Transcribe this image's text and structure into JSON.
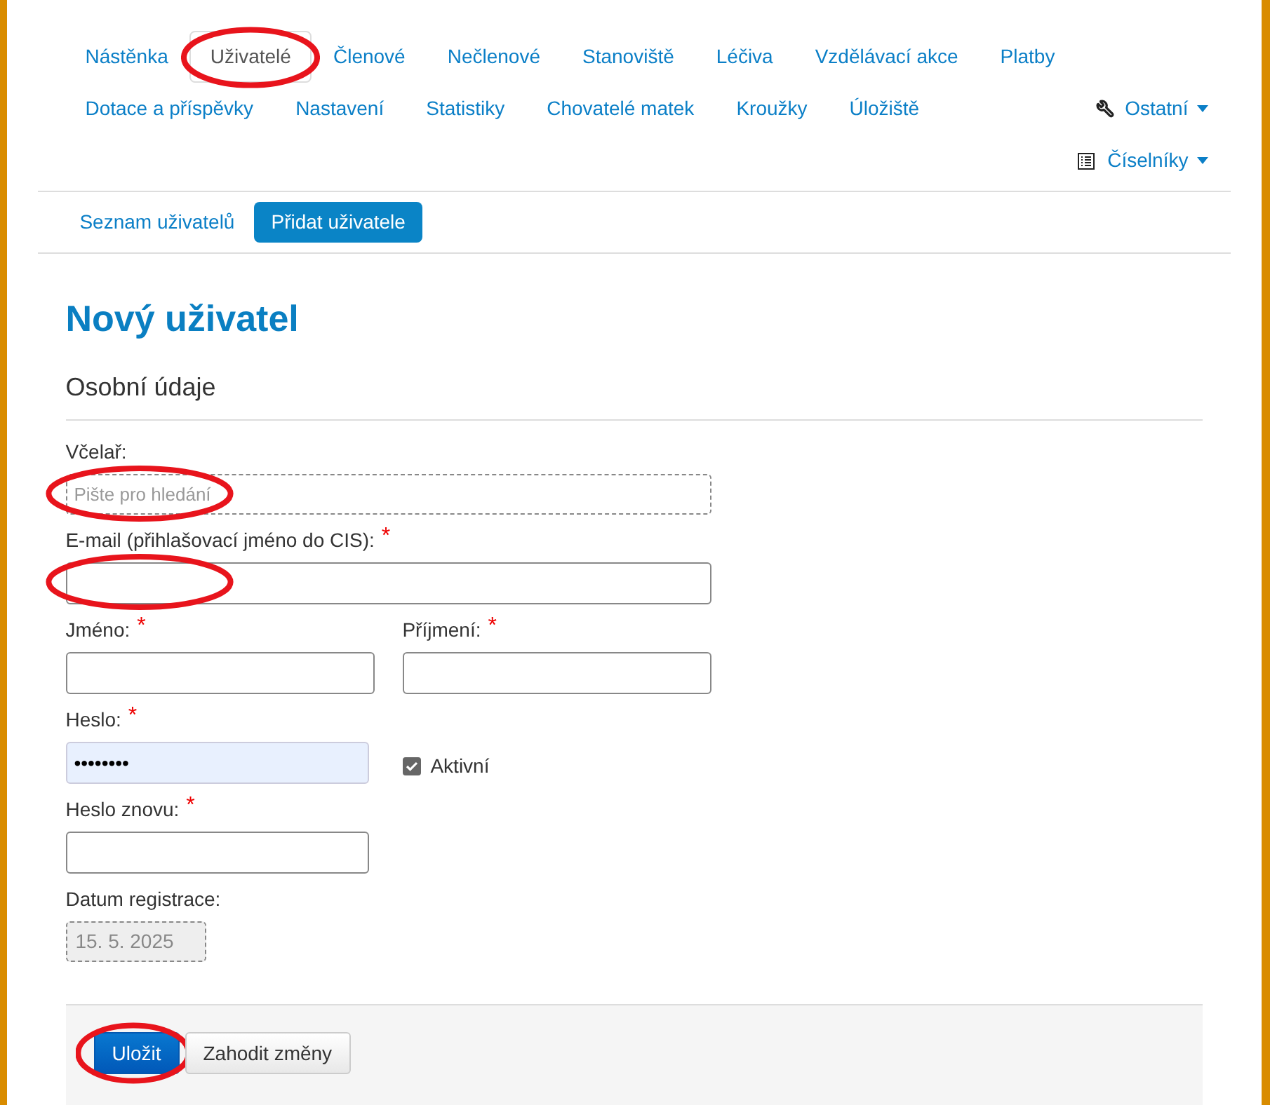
{
  "nav": {
    "items": [
      {
        "label": "Nástěnka",
        "selected": false,
        "circled": false
      },
      {
        "label": "Uživatelé",
        "selected": true,
        "circled": true
      },
      {
        "label": "Členové",
        "selected": false,
        "circled": false
      },
      {
        "label": "Nečlenové",
        "selected": false,
        "circled": false
      },
      {
        "label": "Stanoviště",
        "selected": false,
        "circled": false
      },
      {
        "label": "Léčiva",
        "selected": false,
        "circled": false
      },
      {
        "label": "Vzdělávací akce",
        "selected": false,
        "circled": false
      },
      {
        "label": "Platby",
        "selected": false,
        "circled": false
      },
      {
        "label": "Dotace a příspěvky",
        "selected": false,
        "circled": false
      },
      {
        "label": "Nastavení",
        "selected": false,
        "circled": false
      },
      {
        "label": "Statistiky",
        "selected": false,
        "circled": false
      },
      {
        "label": "Chovatelé matek",
        "selected": false,
        "circled": false
      },
      {
        "label": "Kroužky",
        "selected": false,
        "circled": false
      },
      {
        "label": "Úložiště",
        "selected": false,
        "circled": false
      }
    ],
    "dropdowns": [
      {
        "label": "Ostatní",
        "kind": "wrench"
      },
      {
        "label": "Číselníky",
        "kind": "list"
      }
    ]
  },
  "subnav": [
    {
      "label": "Seznam uživatelů",
      "selected": false
    },
    {
      "label": "Přidat uživatele",
      "selected": true
    }
  ],
  "title": "Nový uživatel",
  "section": "Osobní údaje",
  "rows": [
    [
      {
        "kind": "search",
        "label": "Včelař:",
        "placeholder": "Pište pro hledání",
        "circled": true
      }
    ],
    [
      {
        "kind": "text",
        "label": "E-mail (přihlašovací jméno do CIS):",
        "required_mark": "*",
        "circled": true
      }
    ],
    [
      {
        "kind": "text",
        "label": "Jméno:",
        "required_mark": "*",
        "circled": false
      },
      {
        "kind": "text",
        "label": "Příjmení:",
        "required_mark": "*",
        "circled": false
      }
    ],
    [
      {
        "kind": "password",
        "label": "Heslo:",
        "value": "••••••••",
        "autofilled": true,
        "required_mark": "*",
        "circled": false
      },
      {
        "kind": "checkbox",
        "label": "Aktivní",
        "checked": true
      }
    ],
    [
      {
        "kind": "password",
        "label": "Heslo znovu:",
        "autofilled": false,
        "required_mark": "*",
        "circled": false
      }
    ],
    [
      {
        "kind": "readonly",
        "label": "Datum registrace:",
        "value": "15. 5. 2025",
        "circled": false
      }
    ]
  ],
  "buttons": [
    {
      "label": "Uložit",
      "kind": "primary",
      "circled": true
    },
    {
      "label": "Zahodit změny",
      "kind": "default",
      "circled": false
    }
  ]
}
